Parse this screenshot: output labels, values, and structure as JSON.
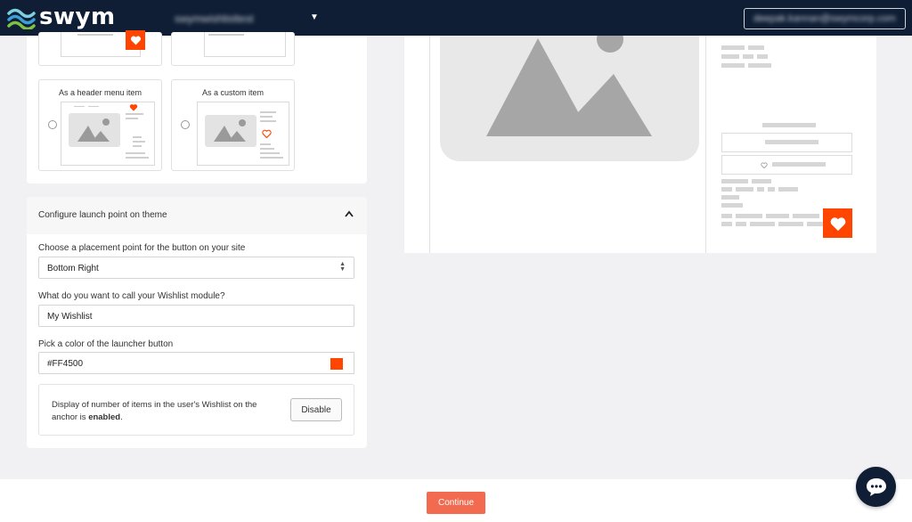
{
  "app": {
    "logo_text": "swym",
    "store_name": "swymwishlisttest",
    "account_email": "deepak.kannan@swymcorp.com"
  },
  "colors": {
    "topbar": "#0f1e35",
    "accent": "#ff4500",
    "continue": "#f26b50"
  },
  "launcher_options": [
    {
      "label": "As a header menu item",
      "selected": false
    },
    {
      "label": "As a custom item",
      "selected": false
    }
  ],
  "config": {
    "title": "Configure launch point on theme",
    "placement_label": "Choose a placement point for the button on your site",
    "placement_value": "Bottom Right",
    "module_name_label": "What do you want to call your Wishlist module?",
    "module_name_value": "My Wishlist",
    "color_label": "Pick a color of the launcher button",
    "color_value": "#FF4500",
    "anchor_text_prefix": "Display of number of items in the user's Wishlist on the anchor is ",
    "anchor_text_status": "enabled",
    "anchor_text_suffix": ".",
    "disable_button": "Disable"
  },
  "footer": {
    "continue_button": "Continue"
  },
  "icons": {
    "logo": "swym-wave-logo",
    "store_dropdown": "caret-down-icon",
    "collapse": "chevron-up-icon",
    "select_arrows": "sort-arrows-icon",
    "wishlist": "heart-icon",
    "placeholder": "image-placeholder-icon",
    "chat": "chat-bubble-icon"
  }
}
